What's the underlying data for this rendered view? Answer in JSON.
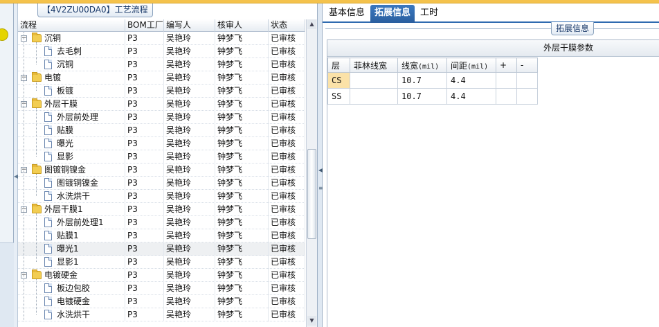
{
  "left_panel": {
    "title": "【4V2ZU00DA0】工艺流程",
    "columns": [
      "流程",
      "BOM工厂",
      "编写人",
      "核审人",
      "状态"
    ],
    "rows": [
      {
        "depth": 1,
        "type": "folder",
        "expanded": true,
        "name": "沉铜",
        "bom": "P3",
        "author": "吴艳玲",
        "reviewer": "钟梦飞",
        "status": "已审核"
      },
      {
        "depth": 2,
        "type": "doc",
        "name": "去毛刺",
        "bom": "P3",
        "author": "吴艳玲",
        "reviewer": "钟梦飞",
        "status": "已审核"
      },
      {
        "depth": 2,
        "type": "doc",
        "name": "沉铜",
        "bom": "P3",
        "author": "吴艳玲",
        "reviewer": "钟梦飞",
        "status": "已审核"
      },
      {
        "depth": 1,
        "type": "folder",
        "expanded": true,
        "name": "电镀",
        "bom": "P3",
        "author": "吴艳玲",
        "reviewer": "钟梦飞",
        "status": "已审核"
      },
      {
        "depth": 2,
        "type": "doc",
        "name": "板镀",
        "bom": "P3",
        "author": "吴艳玲",
        "reviewer": "钟梦飞",
        "status": "已审核"
      },
      {
        "depth": 1,
        "type": "folder",
        "expanded": true,
        "name": "外层干膜",
        "bom": "P3",
        "author": "吴艳玲",
        "reviewer": "钟梦飞",
        "status": "已审核"
      },
      {
        "depth": 2,
        "type": "doc",
        "name": "外层前处理",
        "bom": "P3",
        "author": "吴艳玲",
        "reviewer": "钟梦飞",
        "status": "已审核"
      },
      {
        "depth": 2,
        "type": "doc",
        "name": "贴膜",
        "bom": "P3",
        "author": "吴艳玲",
        "reviewer": "钟梦飞",
        "status": "已审核"
      },
      {
        "depth": 2,
        "type": "doc",
        "name": "曝光",
        "bom": "P3",
        "author": "吴艳玲",
        "reviewer": "钟梦飞",
        "status": "已审核"
      },
      {
        "depth": 2,
        "type": "doc",
        "name": "显影",
        "bom": "P3",
        "author": "吴艳玲",
        "reviewer": "钟梦飞",
        "status": "已审核"
      },
      {
        "depth": 1,
        "type": "folder",
        "expanded": true,
        "name": "图镀铜镍金",
        "bom": "P3",
        "author": "吴艳玲",
        "reviewer": "钟梦飞",
        "status": "已审核"
      },
      {
        "depth": 2,
        "type": "doc",
        "name": "图镀铜镍金",
        "bom": "P3",
        "author": "吴艳玲",
        "reviewer": "钟梦飞",
        "status": "已审核"
      },
      {
        "depth": 2,
        "type": "doc",
        "name": "水洗烘干",
        "bom": "P3",
        "author": "吴艳玲",
        "reviewer": "钟梦飞",
        "status": "已审核"
      },
      {
        "depth": 1,
        "type": "folder",
        "expanded": true,
        "name": "外层干膜1",
        "bom": "P3",
        "author": "吴艳玲",
        "reviewer": "钟梦飞",
        "status": "已审核"
      },
      {
        "depth": 2,
        "type": "doc",
        "name": "外层前处理1",
        "bom": "P3",
        "author": "吴艳玲",
        "reviewer": "钟梦飞",
        "status": "已审核"
      },
      {
        "depth": 2,
        "type": "doc",
        "name": "贴膜1",
        "bom": "P3",
        "author": "吴艳玲",
        "reviewer": "钟梦飞",
        "status": "已审核"
      },
      {
        "depth": 2,
        "type": "doc",
        "name": "曝光1",
        "bom": "P3",
        "author": "吴艳玲",
        "reviewer": "钟梦飞",
        "status": "已审核",
        "selected": true
      },
      {
        "depth": 2,
        "type": "doc",
        "name": "显影1",
        "bom": "P3",
        "author": "吴艳玲",
        "reviewer": "钟梦飞",
        "status": "已审核"
      },
      {
        "depth": 1,
        "type": "folder",
        "expanded": true,
        "name": "电镀硬金",
        "bom": "P3",
        "author": "吴艳玲",
        "reviewer": "钟梦飞",
        "status": "已审核"
      },
      {
        "depth": 2,
        "type": "doc",
        "name": "板边包胶",
        "bom": "P3",
        "author": "吴艳玲",
        "reviewer": "钟梦飞",
        "status": "已审核"
      },
      {
        "depth": 2,
        "type": "doc",
        "name": "电镀硬金",
        "bom": "P3",
        "author": "吴艳玲",
        "reviewer": "钟梦飞",
        "status": "已审核"
      },
      {
        "depth": 2,
        "type": "doc",
        "name": "水洗烘干",
        "bom": "P3",
        "author": "吴艳玲",
        "reviewer": "钟梦飞",
        "status": "已审核"
      }
    ]
  },
  "right_panel": {
    "tabs": [
      {
        "label": "基本信息",
        "active": false
      },
      {
        "label": "拓展信息",
        "active": true
      },
      {
        "label": "工时",
        "active": false
      }
    ],
    "group_title": "拓展信息",
    "grid": {
      "caption": "外层干膜参数",
      "headers": {
        "layer": "层",
        "feilin": "菲林线宽",
        "line_width": "线宽",
        "line_width_unit": "(mil)",
        "spacing": "间距",
        "spacing_unit": "(mil)",
        "plus": "+",
        "minus": "-"
      },
      "rows": [
        {
          "layer": "CS",
          "feilin": "",
          "line_width": "10.7",
          "spacing": "4.4",
          "selected": true
        },
        {
          "layer": "SS",
          "feilin": "",
          "line_width": "10.7",
          "spacing": "4.4",
          "selected": false
        }
      ]
    }
  },
  "colors": {
    "accent_tab": "#2f6bb0",
    "topbar": "#f4c24c",
    "selected_cell": "#fbe2a8"
  }
}
